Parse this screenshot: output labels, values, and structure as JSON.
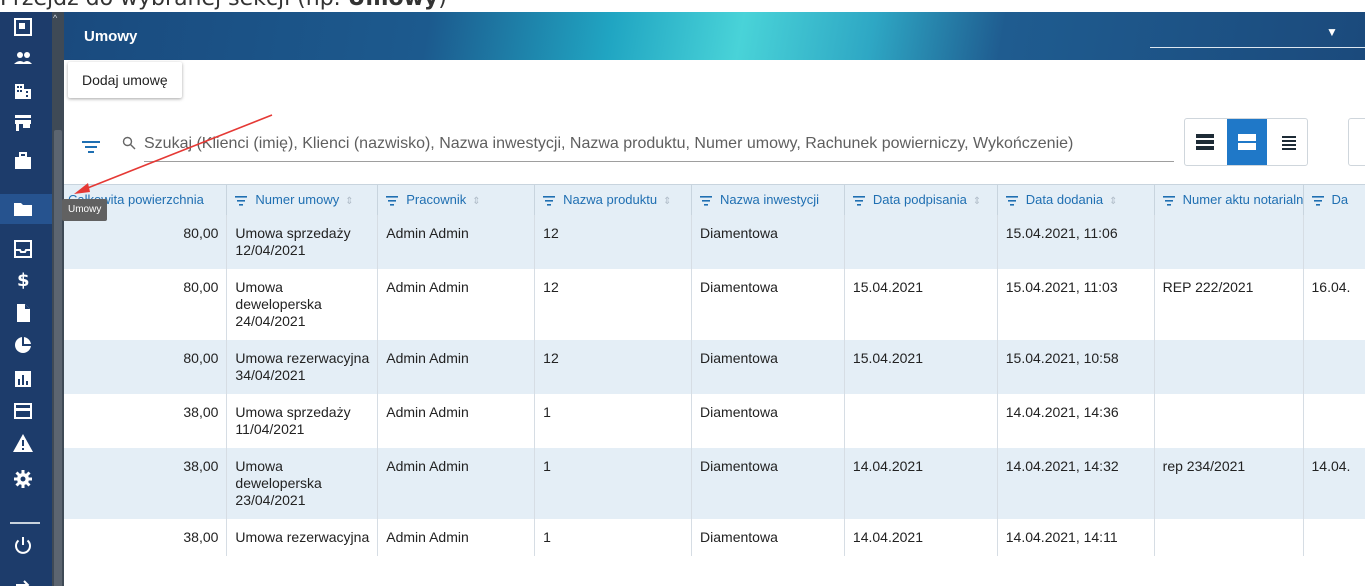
{
  "caption": {
    "prefix": "Przejdź do wybranej sekcji (np. ",
    "bold": "Umowy",
    "suffix": ")"
  },
  "sidebar": {
    "items": [
      {
        "icon": "dashboard-icon"
      },
      {
        "icon": "people-icon"
      },
      {
        "icon": "building-icon"
      },
      {
        "icon": "store-icon"
      },
      {
        "icon": "briefcase-icon"
      },
      {
        "icon": "folder-icon",
        "active": true
      },
      {
        "icon": "inbox-icon"
      },
      {
        "icon": "dollar-icon"
      },
      {
        "icon": "document-icon"
      },
      {
        "icon": "pie-chart-icon"
      },
      {
        "icon": "bar-chart-icon"
      },
      {
        "icon": "card-icon"
      },
      {
        "icon": "warning-icon"
      },
      {
        "icon": "gear-icon"
      },
      {
        "icon": "power-icon"
      }
    ],
    "tooltip": "Umowy"
  },
  "topbar": {
    "title": "Umowy"
  },
  "toolbar": {
    "add_label": "Dodaj umowę"
  },
  "search": {
    "placeholder": "Szukaj (Klienci (imię), Klienci (nazwisko), Nazwa inwestycji, Nazwa produktu, Numer umowy, Rachunek powierniczy, Wykończenie)"
  },
  "table": {
    "columns": [
      "Całkowita powierzchnia",
      "Numer umowy",
      "Pracownik",
      "Nazwa produktu",
      "Nazwa inwestycji",
      "Data podpisania",
      "Data dodania",
      "Numer aktu notarialnego",
      "Da"
    ],
    "rows": [
      {
        "area": "80,00",
        "number": "Umowa sprzedaży 12/04/2021",
        "employee": "Admin Admin",
        "product": "12",
        "investment": "Diamentowa",
        "signed": "",
        "added": "15.04.2021, 11:06",
        "notary": "",
        "extra": ""
      },
      {
        "area": "80,00",
        "number": "Umowa deweloperska 24/04/2021",
        "employee": "Admin Admin",
        "product": "12",
        "investment": "Diamentowa",
        "signed": "15.04.2021",
        "added": "15.04.2021, 11:03",
        "notary": "REP 222/2021",
        "extra": "16.04."
      },
      {
        "area": "80,00",
        "number": "Umowa rezerwacyjna 34/04/2021",
        "employee": "Admin Admin",
        "product": "12",
        "investment": "Diamentowa",
        "signed": "15.04.2021",
        "added": "15.04.2021, 10:58",
        "notary": "",
        "extra": ""
      },
      {
        "area": "38,00",
        "number": "Umowa sprzedaży 11/04/2021",
        "employee": "Admin Admin",
        "product": "1",
        "investment": "Diamentowa",
        "signed": "",
        "added": "14.04.2021, 14:36",
        "notary": "",
        "extra": ""
      },
      {
        "area": "38,00",
        "number": "Umowa deweloperska 23/04/2021",
        "employee": "Admin Admin",
        "product": "1",
        "investment": "Diamentowa",
        "signed": "14.04.2021",
        "added": "14.04.2021, 14:32",
        "notary": "rep 234/2021",
        "extra": "14.04."
      },
      {
        "area": "38,00",
        "number": "Umowa rezerwacyjna",
        "employee": "Admin Admin",
        "product": "1",
        "investment": "Diamentowa",
        "signed": "14.04.2021",
        "added": "14.04.2021, 14:11",
        "notary": "",
        "extra": ""
      }
    ]
  },
  "colors": {
    "accent": "#1f78c8",
    "header_text": "#1f6fb2",
    "row_alt": "#e4eef6",
    "sidebar": "#1d3c6b",
    "annotation_arrow": "#e53935"
  }
}
